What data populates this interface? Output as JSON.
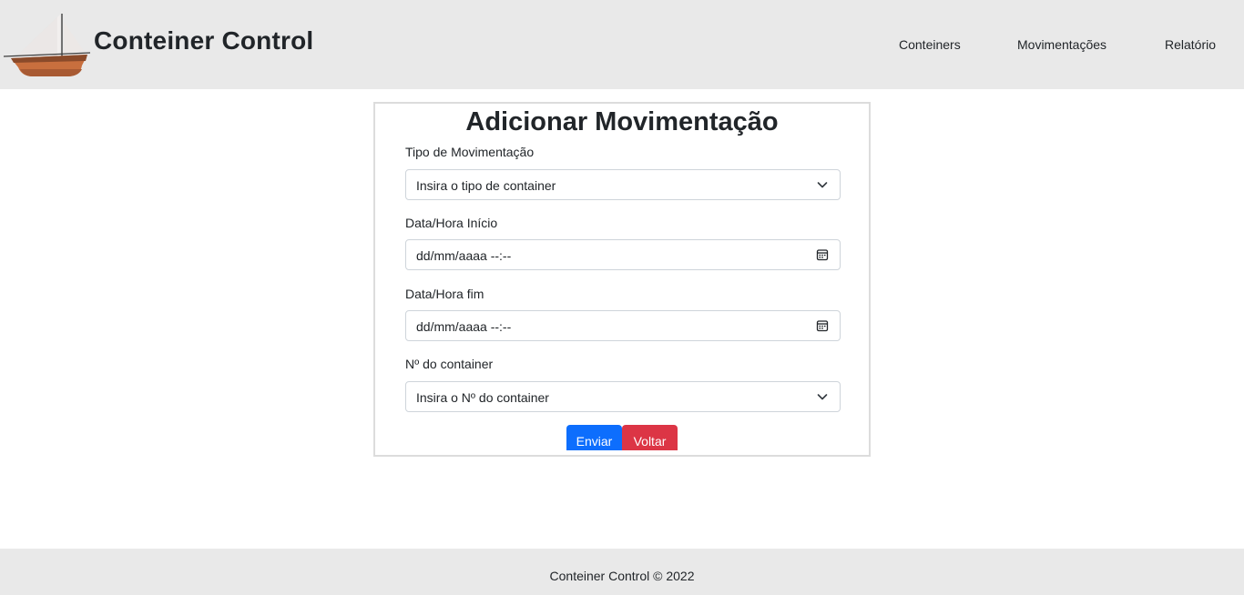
{
  "header": {
    "brand": "Conteiner Control",
    "logo_icon": "sailboat-icon",
    "nav": [
      {
        "label": "Conteiners"
      },
      {
        "label": "Movimentações"
      },
      {
        "label": "Relatório"
      }
    ]
  },
  "form": {
    "title": "Adicionar Movimentação",
    "tipo": {
      "label": "Tipo de Movimentação",
      "value": "Insira o tipo de container",
      "icon": "chevron-down-icon"
    },
    "inicio": {
      "label": "Data/Hora Início",
      "value": "dd/mm/aaaa --:--",
      "icon": "calendar-icon"
    },
    "fim": {
      "label": "Data/Hora fim",
      "value": "dd/mm/aaaa --:--",
      "icon": "calendar-icon"
    },
    "container": {
      "label": "Nº do container",
      "value": "Insira o Nº do container",
      "icon": "chevron-down-icon"
    },
    "buttons": {
      "send": "Enviar",
      "back": "Voltar"
    }
  },
  "colors": {
    "primary": "#0d6efd",
    "danger": "#dc3545",
    "bar": "#e9e9e9"
  },
  "footer": {
    "text": "Conteiner Control © 2022"
  }
}
